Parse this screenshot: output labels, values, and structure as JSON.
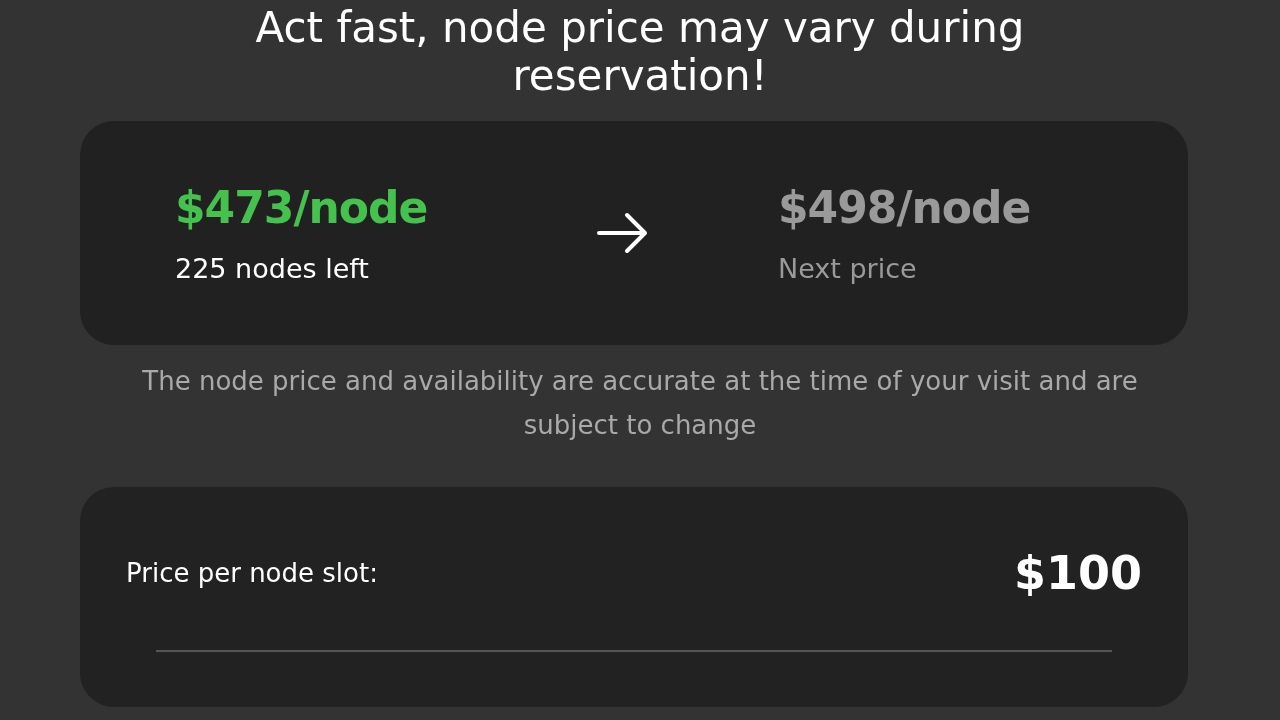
{
  "heading": "Act fast, node price may vary during reservation!",
  "current": {
    "price": "$473/node",
    "note": "225 nodes left"
  },
  "next": {
    "price": "$498/node",
    "note": "Next price"
  },
  "disclaimer": "The node price and availability are accurate at the time of your visit and are subject to change",
  "slot": {
    "label": "Price per node slot:",
    "value": "$100"
  }
}
